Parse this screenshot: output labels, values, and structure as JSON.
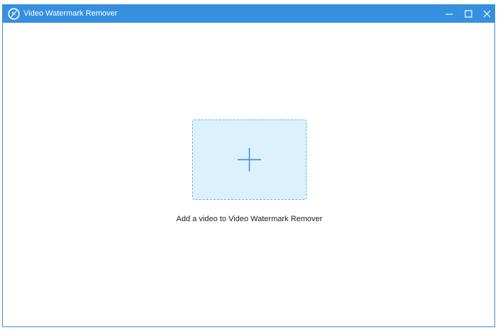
{
  "window": {
    "title": "Video Watermark Remover",
    "app_icon": "app-logo-icon",
    "controls": {
      "minimize_icon": "minimize-icon",
      "maximize_icon": "maximize-icon",
      "close_icon": "close-icon"
    }
  },
  "main": {
    "dropzone_icon": "plus-icon",
    "hint": "Add a video to Video Watermark Remover"
  },
  "colors": {
    "titlebar": "#3591e0",
    "dropzone_fill": "#dcf0fd",
    "dropzone_border": "#6fb6ea",
    "plus": "#2f86d3"
  }
}
